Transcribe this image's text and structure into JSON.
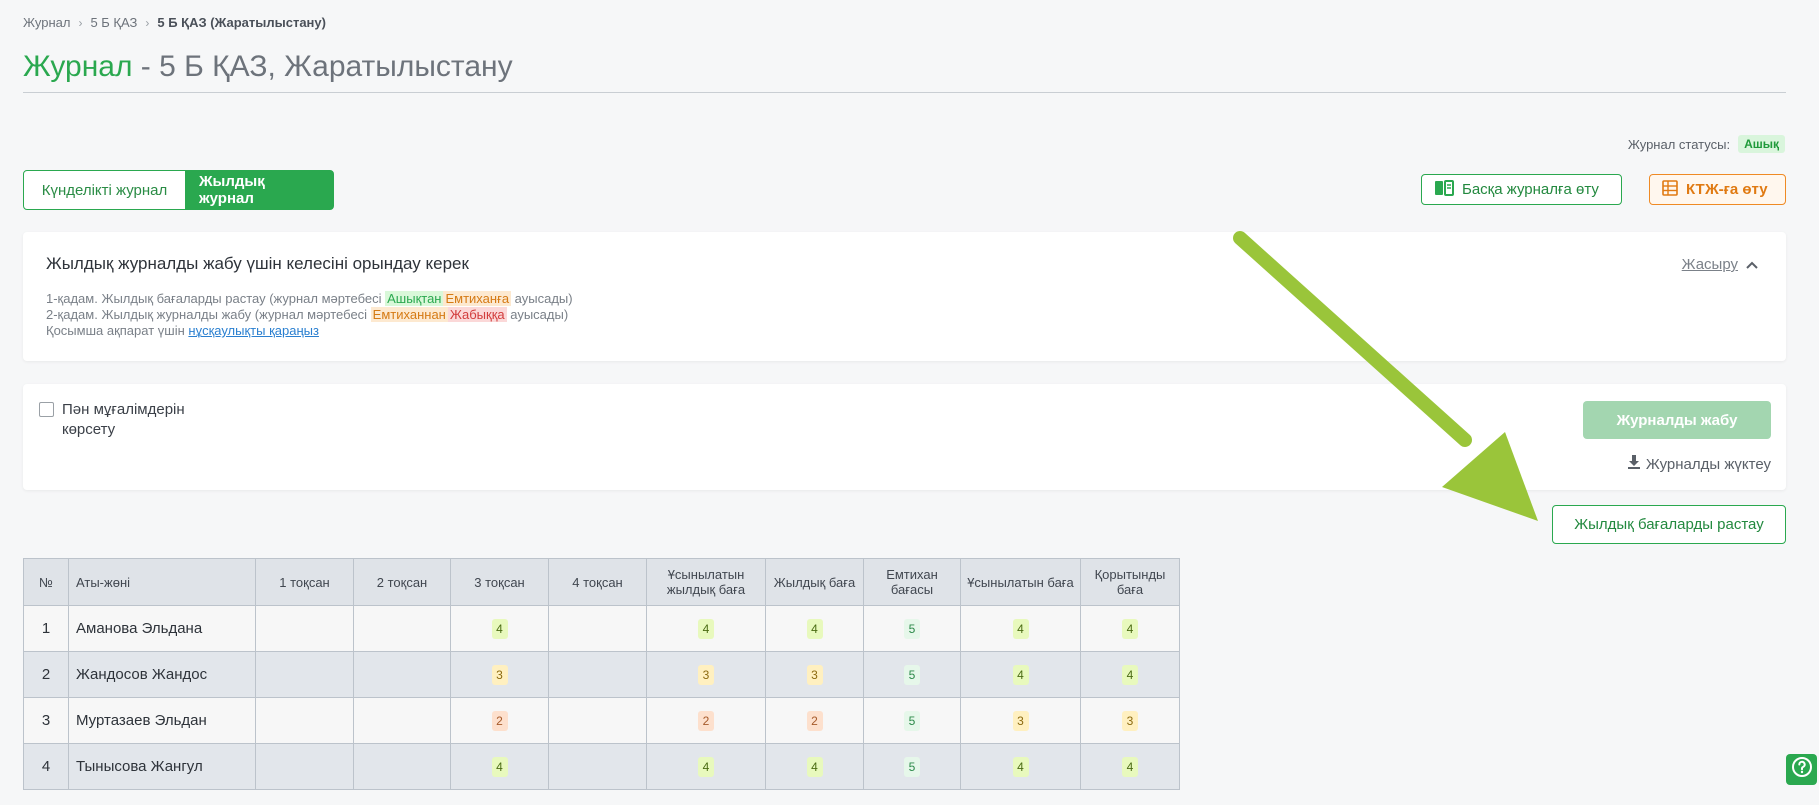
{
  "breadcrumb": {
    "items": [
      "Журнал",
      "5 Б ҚАЗ"
    ],
    "current": "5 Б ҚАЗ (Жаратылыстану)"
  },
  "title": {
    "main": "Журнал",
    "rest": " - 5 Б ҚАЗ, Жаратылыстану"
  },
  "status": {
    "label": "Журнал статусы:",
    "value": "Ашық"
  },
  "tabs": {
    "daily": "Күнделікті журнал",
    "annual": "Жылдық журнал"
  },
  "buttons": {
    "other_journal": "Басқа журналға өту",
    "ktzh": "КТЖ-ға өту",
    "close_journal": "Журналды жабу",
    "download": "Журналды жүктеу",
    "approve": "Жылдық бағаларды растау"
  },
  "info": {
    "heading": "Жылдық журналды жабу үшін келесіні орындау керек",
    "hide": "Жасыру",
    "step1_prefix": "1-қадам. Жылдық бағаларды растау (журнал мәртебесі ",
    "step1_from": "Ашықтан",
    "step1_to": "Емтиханға",
    "step1_suffix": " ауысады)",
    "step2_prefix": "2-қадам. Жылдық журналды жабу (журнал мәртебесі ",
    "step2_from": "Емтиханнан",
    "step2_to": "Жабыққа",
    "step2_suffix": " ауысады)",
    "extra_prefix": "Қосымша ақпарат үшін ",
    "extra_link": "нұсқаулықты қараңыз"
  },
  "options": {
    "show_teachers": "Пән мұғалімдерін көрсету"
  },
  "table": {
    "headers": [
      "№",
      "Аты-жөні",
      "1 тоқсан",
      "2 тоқсан",
      "3 тоқсан",
      "4 тоқсан",
      "Ұсынылатын жылдық баға",
      "Жылдық баға",
      "Емтихан бағасы",
      "Ұсынылатын баға",
      "Қорытынды баға"
    ],
    "rows": [
      {
        "n": "1",
        "name": "Аманова Эльдана",
        "q1": "",
        "q2": "",
        "q3": "4",
        "q4": "",
        "rec_annual": "4",
        "annual": "4",
        "exam": "5",
        "rec": "4",
        "final": "4"
      },
      {
        "n": "2",
        "name": "Жандосов Жандос",
        "q1": "",
        "q2": "",
        "q3": "3",
        "q4": "",
        "rec_annual": "3",
        "annual": "3",
        "exam": "5",
        "rec": "4",
        "final": "4"
      },
      {
        "n": "3",
        "name": "Муртазаев Эльдан",
        "q1": "",
        "q2": "",
        "q3": "2",
        "q4": "",
        "rec_annual": "2",
        "annual": "2",
        "exam": "5",
        "rec": "3",
        "final": "3"
      },
      {
        "n": "4",
        "name": "Тынысова Жангул",
        "q1": "",
        "q2": "",
        "q3": "4",
        "q4": "",
        "rec_annual": "4",
        "annual": "4",
        "exam": "5",
        "rec": "4",
        "final": "4"
      }
    ]
  },
  "colors": {
    "accent": "#2aa84f",
    "orange": "#ef8a24",
    "arrow": "#9ac53a"
  },
  "icons": {
    "help": "question-circle-icon",
    "download": "download-icon",
    "book": "book-icon",
    "table": "table-icon"
  }
}
